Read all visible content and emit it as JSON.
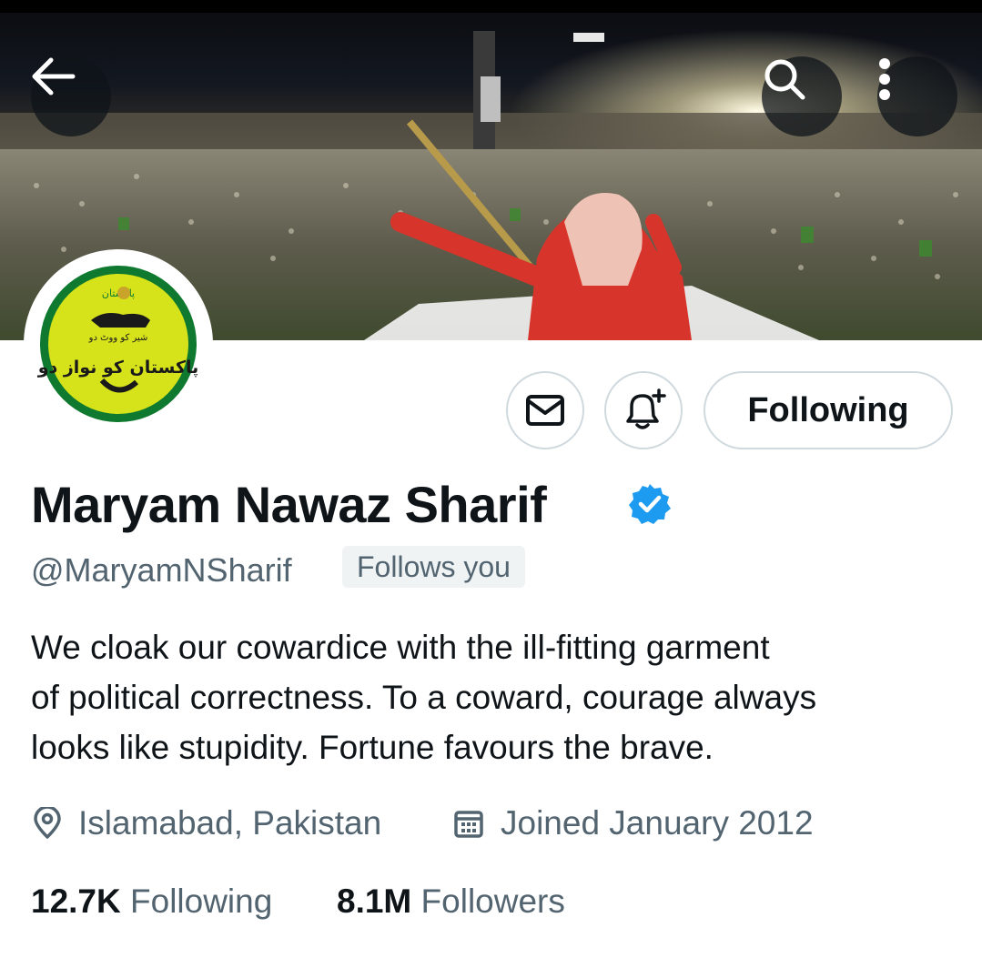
{
  "header": {
    "back_icon": "arrow-left-icon",
    "search_icon": "search-icon",
    "more_icon": "more-vertical-icon"
  },
  "avatar": {
    "logo_text_top": "پاکستان",
    "logo_text_mid": "شیر کو ووٹ دو",
    "logo_text_main": "پاکستان کو نواز دو"
  },
  "actions": {
    "message_icon": "mail-icon",
    "notify_icon": "bell-plus-icon",
    "follow_label": "Following"
  },
  "profile": {
    "name": "Maryam Nawaz Sharif",
    "verified_icon": "verified-badge-icon",
    "handle": "@MaryamNSharif",
    "follows_you": "Follows you",
    "bio_lines": [
      "We cloak our cowardice with the ill-fitting garment",
      "of political correctness. To a coward, courage always",
      "looks like stupidity. Fortune favours the brave."
    ],
    "location": "Islamabad, Pakistan",
    "joined": "Joined January 2012"
  },
  "stats": {
    "following_count": "12.7K",
    "following_label": "Following",
    "followers_count": "8.1M",
    "followers_label": "Followers"
  },
  "colors": {
    "accent_verified": "#1d9bf0",
    "secondary_text": "#536471",
    "logo_green": "#0f7a2f",
    "logo_yellow": "#d6e21a"
  }
}
